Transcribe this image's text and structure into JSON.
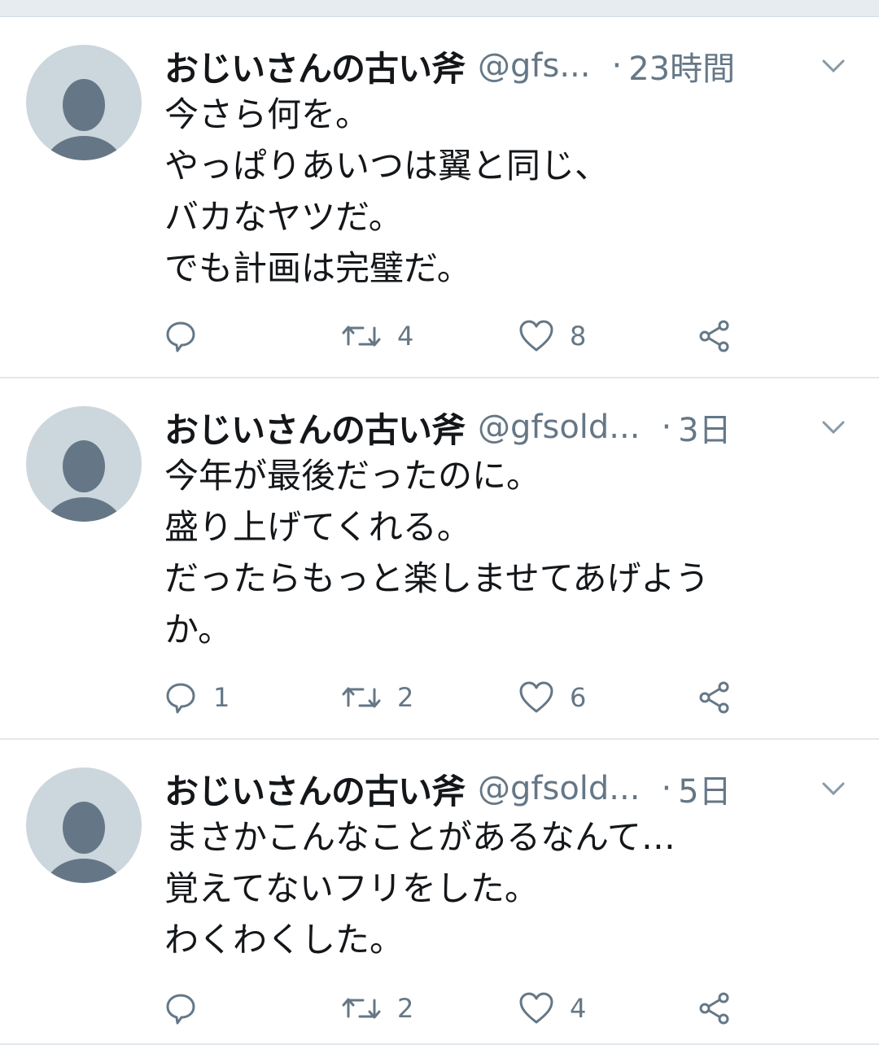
{
  "tweets": [
    {
      "name": "おじいさんの古い斧",
      "handle": "@gfs...",
      "time": "23時間",
      "lines": [
        "今さら何を。",
        "やっぱりあいつは翼と同じ、",
        "バカなヤツだ。",
        "でも計画は完璧だ。"
      ],
      "replies": "",
      "retweets": "4",
      "likes": "8"
    },
    {
      "name": "おじいさんの古い斧",
      "handle": "@gfsold...",
      "time": "3日",
      "lines": [
        "今年が最後だったのに。",
        "盛り上げてくれる。",
        "だったらもっと楽しませてあげよう",
        "か。"
      ],
      "replies": "1",
      "retweets": "2",
      "likes": "6"
    },
    {
      "name": "おじいさんの古い斧",
      "handle": "@gfsold...",
      "time": "5日",
      "lines": [
        "まさかこんなことがあるなんて…",
        "覚えてないフリをした。",
        "わくわくした。"
      ],
      "replies": "",
      "retweets": "2",
      "likes": "4"
    }
  ],
  "separator": "·",
  "colors": {
    "text": "#14171a",
    "secondary": "#657786",
    "avatar_bg": "#ccd6dd",
    "avatar_fg": "#657786",
    "divider": "#e1e8ed"
  }
}
